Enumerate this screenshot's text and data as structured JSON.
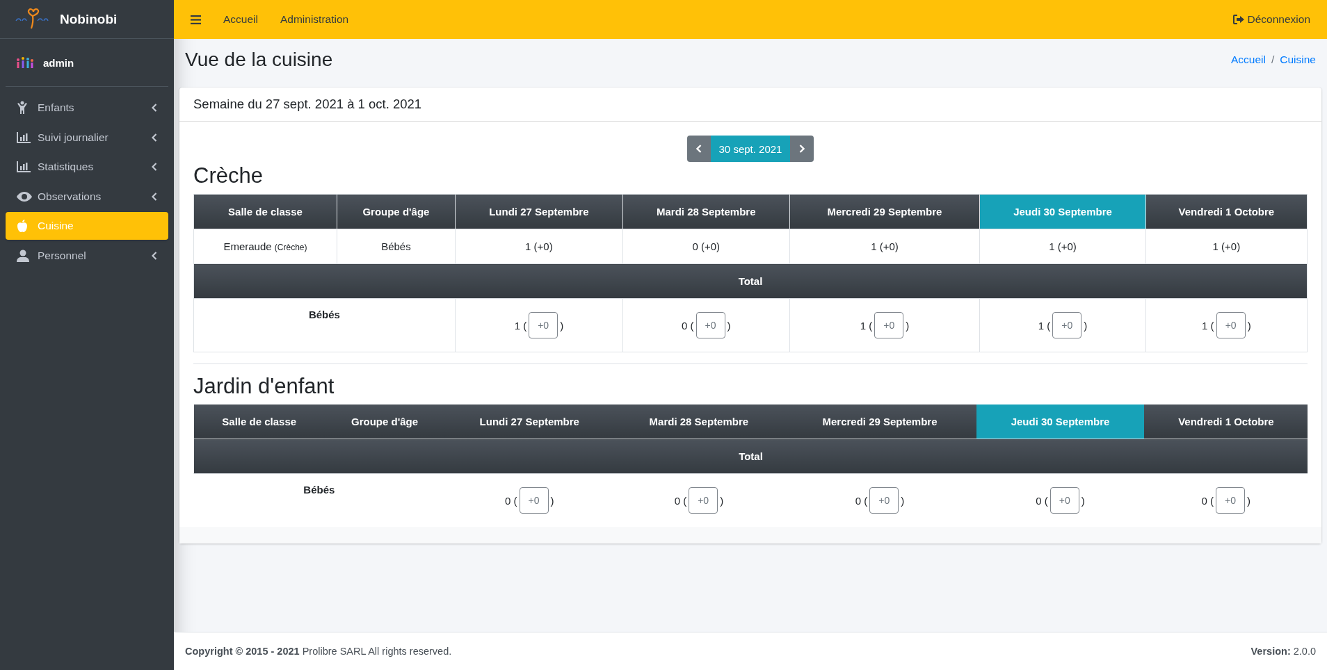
{
  "brand": {
    "name": "Nobinobi"
  },
  "user": {
    "name": "admin"
  },
  "sidebar": {
    "items": [
      {
        "label": "Enfants",
        "kind": "child",
        "expandable": true,
        "selected": false
      },
      {
        "label": "Suivi journalier",
        "kind": "chart",
        "expandable": true,
        "selected": false
      },
      {
        "label": "Statistiques",
        "kind": "chart",
        "expandable": true,
        "selected": false
      },
      {
        "label": "Observations",
        "kind": "eye",
        "expandable": true,
        "selected": false
      },
      {
        "label": "Cuisine",
        "kind": "apple",
        "expandable": false,
        "selected": true
      },
      {
        "label": "Personnel",
        "kind": "user",
        "expandable": true,
        "selected": false
      }
    ]
  },
  "topbar": {
    "links": [
      "Accueil",
      "Administration"
    ],
    "logout": "Déconnexion"
  },
  "page": {
    "title": "Vue de la cuisine",
    "breadcrumb": [
      "Accueil",
      "Cuisine"
    ],
    "breadcrumb_separator": "/"
  },
  "card": {
    "header": "Semaine du 27 sept. 2021 à 1 oct. 2021",
    "date": "30 sept. 2021",
    "sections": [
      {
        "title": "Crèche",
        "bordered": true,
        "columns": [
          {
            "label": "Salle de classe",
            "selected": false
          },
          {
            "label": "Groupe d'âge",
            "selected": false
          },
          {
            "label": "Lundi 27 Septembre",
            "selected": false
          },
          {
            "label": "Mardi 28 Septembre",
            "selected": false
          },
          {
            "label": "Mercredi 29 Septembre",
            "selected": false
          },
          {
            "label": "Jeudi 30 Septembre",
            "selected": true
          },
          {
            "label": "Vendredi 1 Octobre",
            "selected": false
          }
        ],
        "rows": [
          {
            "room": "Emeraude",
            "room_note": "(Crèche)",
            "group": "Bébés",
            "values": [
              "1 (+0)",
              "0 (+0)",
              "1 (+0)",
              "1 (+0)",
              "1 (+0)"
            ]
          }
        ],
        "total_label": "Total",
        "totals": [
          {
            "group": "Bébés",
            "cells": [
              {
                "before": "1 (",
                "placeholder": "+0",
                "after": ")"
              },
              {
                "before": "0 (",
                "placeholder": "+0",
                "after": ")"
              },
              {
                "before": "1 (",
                "placeholder": "+0",
                "after": ")"
              },
              {
                "before": "1 (",
                "placeholder": "+0",
                "after": ")"
              },
              {
                "before": "1 (",
                "placeholder": "+0",
                "after": ")"
              }
            ]
          }
        ]
      },
      {
        "title": "Jardin d'enfant",
        "bordered": false,
        "columns": [
          {
            "label": "Salle de classe",
            "selected": false
          },
          {
            "label": "Groupe d'âge",
            "selected": false
          },
          {
            "label": "Lundi 27 Septembre",
            "selected": false
          },
          {
            "label": "Mardi 28 Septembre",
            "selected": false
          },
          {
            "label": "Mercredi 29 Septembre",
            "selected": false
          },
          {
            "label": "Jeudi 30 Septembre",
            "selected": true
          },
          {
            "label": "Vendredi 1 Octobre",
            "selected": false
          }
        ],
        "total_label": "Total",
        "totals": [
          {
            "group": "Bébés",
            "cells": [
              {
                "before": "0 (",
                "placeholder": "+0",
                "after": ")"
              },
              {
                "before": "0 (",
                "placeholder": "+0",
                "after": ")"
              },
              {
                "before": "0 (",
                "placeholder": "+0",
                "after": ")"
              },
              {
                "before": "0 (",
                "placeholder": "+0",
                "after": ")"
              },
              {
                "before": "0 (",
                "placeholder": "+0",
                "after": ")"
              }
            ]
          }
        ]
      }
    ]
  },
  "footer": {
    "copyright": "**Copyright © 2015 - 2021** Prolibre SARL All rights reserved.",
    "version": "**Version:** 2.0.0"
  }
}
